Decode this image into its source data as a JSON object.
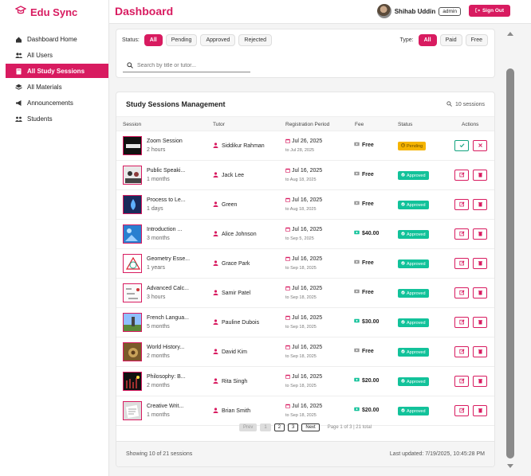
{
  "app": {
    "name": "Edu Sync"
  },
  "sidebar": {
    "items": [
      {
        "label": "Dashboard Home",
        "icon": "home-icon"
      },
      {
        "label": "All Users",
        "icon": "users-icon"
      },
      {
        "label": "All Study Sessions",
        "icon": "book-icon",
        "active": true
      },
      {
        "label": "All Materials",
        "icon": "layers-icon"
      },
      {
        "label": "Announcements",
        "icon": "megaphone-icon"
      },
      {
        "label": "Students",
        "icon": "students-icon"
      }
    ]
  },
  "header": {
    "title": "Dashboard",
    "user_name": "Shihab Uddin",
    "role": "admin",
    "signout_label": "Sign Out"
  },
  "filters": {
    "status_label": "Status:",
    "status_options": [
      "All",
      "Pending",
      "Approved",
      "Rejected"
    ],
    "type_label": "Type:",
    "type_options": [
      "All",
      "Paid",
      "Free"
    ],
    "search_placeholder": "Search by title or tutor..."
  },
  "table": {
    "title": "Study Sessions Management",
    "count_label": "10 sessions",
    "columns": [
      "Session",
      "Tutor",
      "Registration Period",
      "Fee",
      "Status",
      "Actions"
    ],
    "rows": [
      {
        "title": "Zoom Session",
        "duration": "2 hours",
        "tutor": "Siddikur Rahman",
        "reg_start": "Jul 26, 2025",
        "reg_end": "to Jul 28, 2025",
        "fee": "Free",
        "status": "Pending"
      },
      {
        "title": "Public Speaki...",
        "duration": "1 months",
        "tutor": "Jack Lee",
        "reg_start": "Jul 16, 2025",
        "reg_end": "to Aug 18, 2025",
        "fee": "Free",
        "status": "Approved"
      },
      {
        "title": "Process to Le...",
        "duration": "1 days",
        "tutor": "Green",
        "reg_start": "Jul 16, 2025",
        "reg_end": "to Aug 18, 2025",
        "fee": "Free",
        "status": "Approved"
      },
      {
        "title": "Introduction ...",
        "duration": "3 months",
        "tutor": "Alice Johnson",
        "reg_start": "Jul 16, 2025",
        "reg_end": "to Sep 5, 2025",
        "fee": "$40.00",
        "status": "Approved"
      },
      {
        "title": "Geometry Esse...",
        "duration": "1 years",
        "tutor": "Grace Park",
        "reg_start": "Jul 16, 2025",
        "reg_end": "to Sep 18, 2025",
        "fee": "Free",
        "status": "Approved"
      },
      {
        "title": "Advanced Calc...",
        "duration": "3 hours",
        "tutor": "Samir Patel",
        "reg_start": "Jul 16, 2025",
        "reg_end": "to Sep 18, 2025",
        "fee": "Free",
        "status": "Approved"
      },
      {
        "title": "French Langua...",
        "duration": "5 months",
        "tutor": "Pauline Dubois",
        "reg_start": "Jul 16, 2025",
        "reg_end": "to Sep 18, 2025",
        "fee": "$30.00",
        "status": "Approved"
      },
      {
        "title": "World History...",
        "duration": "2 months",
        "tutor": "David Kim",
        "reg_start": "Jul 16, 2025",
        "reg_end": "to Sep 18, 2025",
        "fee": "Free",
        "status": "Approved"
      },
      {
        "title": "Philosophy: B...",
        "duration": "2 months",
        "tutor": "Rita Singh",
        "reg_start": "Jul 16, 2025",
        "reg_end": "to Sep 18, 2025",
        "fee": "$20.00",
        "status": "Approved"
      },
      {
        "title": "Creative Writ...",
        "duration": "1 months",
        "tutor": "Brian Smith",
        "reg_start": "Jul 16, 2025",
        "reg_end": "to Sep 18, 2025",
        "fee": "$20.00",
        "status": "Approved"
      }
    ]
  },
  "pagination": {
    "prev": "Prev",
    "pages": [
      "1",
      "2",
      "3"
    ],
    "next": "Next",
    "info": "Page 1 of 3 | 21 total"
  },
  "footer": {
    "showing": "Showing 10 of 21 sessions",
    "last_updated": "Last updated: 7/19/2025, 10:45:28 PM"
  },
  "colors": {
    "brand": "#d81b60",
    "approved": "#12c29a",
    "pending": "#f5b400"
  }
}
